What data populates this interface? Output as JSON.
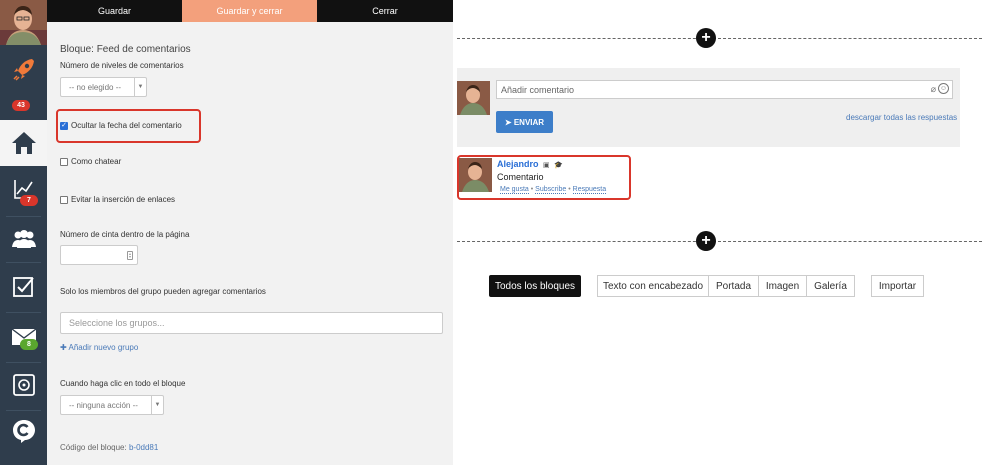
{
  "toolbar": {
    "save": "Guardar",
    "save_close": "Guardar y cerrar",
    "close": "Cerrar"
  },
  "sidebar": {
    "badges": {
      "notifications": "43",
      "stats": "7",
      "messages": "8"
    },
    "icons": [
      "rocket-icon",
      "home-icon",
      "chart-icon",
      "users-icon",
      "checkbox-icon",
      "mail-icon",
      "safe-icon",
      "c-icon"
    ]
  },
  "panel": {
    "title": "Bloque: Feed de comentarios",
    "levels_label": "Número de niveles de comentarios",
    "levels_value": "-- no elegido --",
    "hide_date": "Ocultar la fecha del comentario",
    "hide_date_checked": true,
    "chat_like": "Como chatear",
    "avoid_links": "Evitar la inserción de enlaces",
    "tape_label": "Número de cinta dentro de la página",
    "members_label": "Solo los miembros del grupo pueden agregar comentarios",
    "groups_placeholder": "Seleccione los grupos...",
    "add_group": "Añadir nuevo grupo",
    "click_label": "Cuando haga clic en todo el bloque",
    "click_value": "-- ninguna acción --",
    "code_label": "Código del bloque:",
    "code_value": "b-0dd81"
  },
  "preview": {
    "comment_placeholder": "Añadir comentario",
    "send": "ENVIAR",
    "download_all": "descargar todas las respuestas",
    "comment": {
      "author": "Alejandro",
      "text": "Comentario",
      "like": "Me gusta",
      "subscribe": "Subscribe",
      "reply": "Respuesta"
    }
  },
  "blocks": {
    "all": "Todos los bloques",
    "text_header": "Texto con encabezado",
    "cover": "Portada",
    "image": "Imagen",
    "gallery": "Galería",
    "import": "Importar"
  },
  "colors": {
    "accent": "#f3a07c",
    "rail": "#2f3d4c",
    "link": "#4a7ab8",
    "highlight": "#d9362b",
    "send": "#3d7ec9"
  }
}
